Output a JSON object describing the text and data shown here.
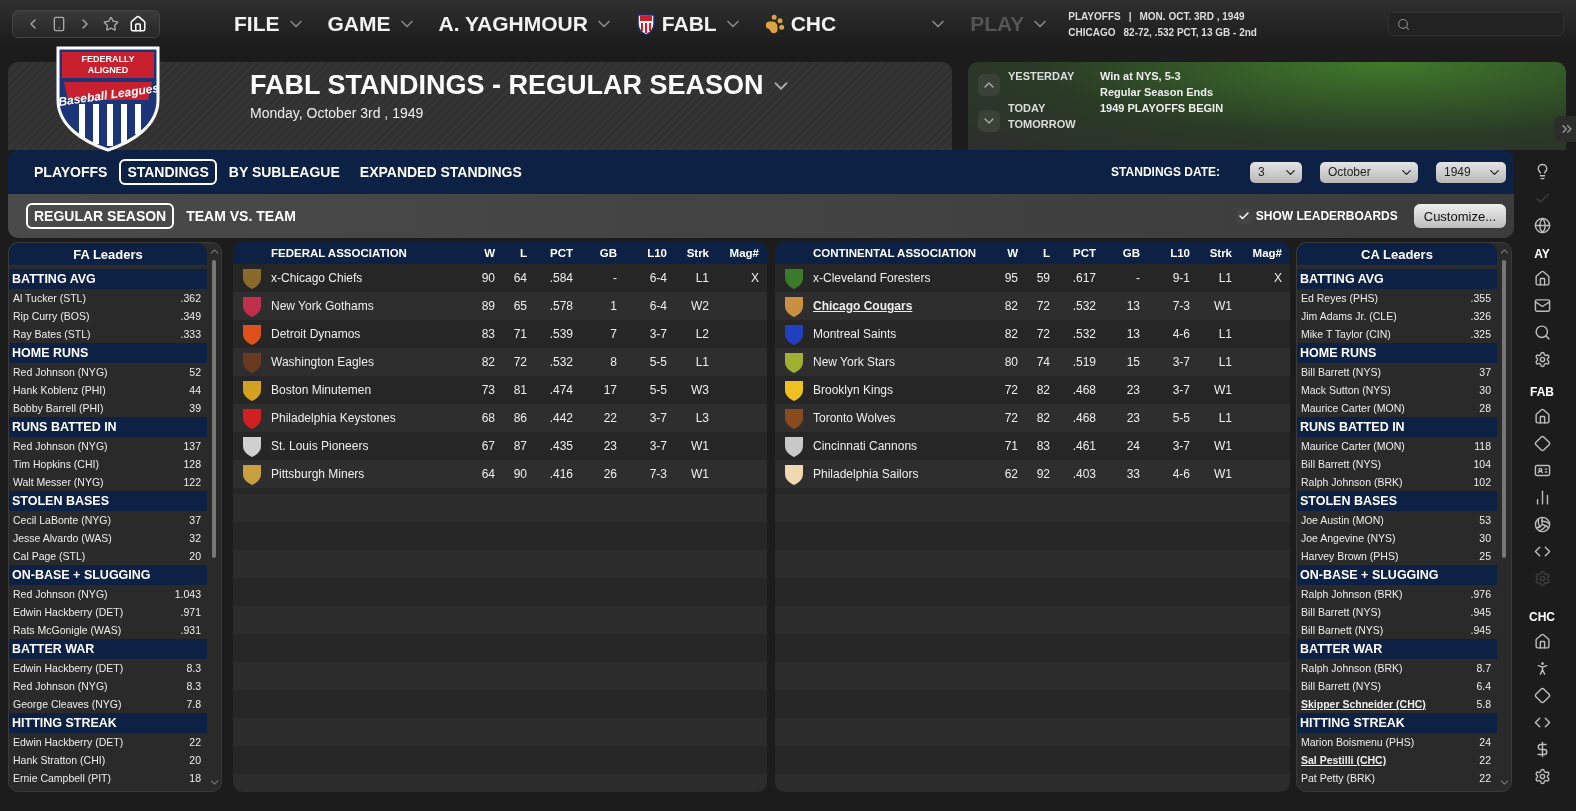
{
  "menu": [
    {
      "kind": "text",
      "label": "FILE",
      "caret": true,
      "disabled": false
    },
    {
      "kind": "text",
      "label": "GAME",
      "caret": true,
      "disabled": false
    },
    {
      "kind": "text",
      "label": "A. YAGHMOUR",
      "caret": true,
      "disabled": false
    },
    {
      "kind": "league",
      "label": "FABL",
      "caret": true,
      "disabled": false
    },
    {
      "kind": "team",
      "label": "CHC",
      "caret": false,
      "disabled": false
    },
    {
      "kind": "blank",
      "caret": true,
      "disabled": false
    },
    {
      "kind": "text",
      "label": "PLAY",
      "caret": true,
      "disabled": true
    }
  ],
  "status": {
    "phase": "PLAYOFFS",
    "separator": "|",
    "date": "MON. OCT. 3RD , 1949",
    "team": "CHICAGO",
    "record": "82-72, .532 PCT, 13 GB - 2nd"
  },
  "header": {
    "logo_lines": [
      "FEDERALLY",
      "ALIGNED",
      "Baseball Leagues"
    ],
    "title": "FABL STANDINGS - REGULAR SEASON",
    "subtitle": "Monday, October 3rd , 1949"
  },
  "schedule": [
    {
      "day": "YESTERDAY",
      "events": [
        "Win at NYS, 5-3",
        "Regular Season Ends"
      ]
    },
    {
      "day": "TODAY",
      "events": [
        "1949 PLAYOFFS BEGIN"
      ]
    },
    {
      "day": "TOMORROW"
    }
  ],
  "tabs": [
    {
      "label": "PLAYOFFS",
      "selected": false
    },
    {
      "label": "STANDINGS",
      "selected": true
    },
    {
      "label": "BY SUBLEAGUE",
      "selected": false
    },
    {
      "label": "EXPANDED STANDINGS",
      "selected": false
    }
  ],
  "standings_date": {
    "label": "STANDINGS DATE:",
    "day": "3",
    "month": "October",
    "year": "1949"
  },
  "subtabs": [
    {
      "label": "REGULAR SEASON",
      "selected": true
    },
    {
      "label": "TEAM VS. TEAM",
      "selected": false
    }
  ],
  "show_leaderboards": {
    "label": "SHOW LEADERBOARDS",
    "checked": true
  },
  "customize_button": "Customize...",
  "fa_leaders": {
    "title": "FA Leaders",
    "sections": [
      {
        "title": "BATTING AVG",
        "rows": [
          {
            "name": "Al Tucker (STL)",
            "value": ".362",
            "underlined": false
          },
          {
            "name": "Rip Curry (BOS)",
            "value": ".349",
            "underlined": false
          },
          {
            "name": "Ray Bates (STL)",
            "value": ".333",
            "underlined": false
          }
        ]
      },
      {
        "title": "HOME RUNS",
        "rows": [
          {
            "name": "Red Johnson (NYG)",
            "value": "52",
            "underlined": false
          },
          {
            "name": "Hank Koblenz (PHI)",
            "value": "44",
            "underlined": false
          },
          {
            "name": "Bobby Barrell (PHI)",
            "value": "39",
            "underlined": false
          }
        ]
      },
      {
        "title": "RUNS BATTED IN",
        "rows": [
          {
            "name": "Red Johnson (NYG)",
            "value": "137",
            "underlined": false
          },
          {
            "name": "Tim Hopkins (CHI)",
            "value": "128",
            "underlined": false
          },
          {
            "name": "Walt Messer (NYG)",
            "value": "122",
            "underlined": false
          }
        ]
      },
      {
        "title": "STOLEN BASES",
        "rows": [
          {
            "name": "Cecil LaBonte (NYG)",
            "value": "37",
            "underlined": false
          },
          {
            "name": "Jesse Alvardo (WAS)",
            "value": "32",
            "underlined": false
          },
          {
            "name": "Cal Page (STL)",
            "value": "20",
            "underlined": false
          }
        ]
      },
      {
        "title": "ON-BASE + SLUGGING",
        "rows": [
          {
            "name": "Red Johnson (NYG)",
            "value": "1.043",
            "underlined": false
          },
          {
            "name": "Edwin Hackberry (DET)",
            "value": ".971",
            "underlined": false
          },
          {
            "name": "Rats McGonigle (WAS)",
            "value": ".931",
            "underlined": false
          }
        ]
      },
      {
        "title": "BATTER WAR",
        "rows": [
          {
            "name": "Edwin Hackberry (DET)",
            "value": "8.3",
            "underlined": false
          },
          {
            "name": "Red Johnson (NYG)",
            "value": "8.3",
            "underlined": false
          },
          {
            "name": "George Cleaves (NYG)",
            "value": "7.8",
            "underlined": false
          }
        ]
      },
      {
        "title": "HITTING STREAK",
        "rows": [
          {
            "name": "Edwin Hackberry (DET)",
            "value": "22",
            "underlined": false
          },
          {
            "name": "Hank Stratton (CHI)",
            "value": "20",
            "underlined": false
          },
          {
            "name": "Ernie Campbell (PIT)",
            "value": "18",
            "underlined": false
          }
        ]
      }
    ]
  },
  "fa_standings": {
    "columns": [
      "FEDERAL ASSOCIATION",
      "W",
      "L",
      "PCT",
      "GB",
      "L10",
      "Strk",
      "Mag#"
    ],
    "rows": [
      {
        "color": "#8a6a2a",
        "underlined": false,
        "cells": [
          "x-Chicago Chiefs",
          "90",
          "64",
          ".584",
          "-",
          "6-4",
          "L1",
          "X"
        ]
      },
      {
        "color": "#c0304a",
        "underlined": false,
        "cells": [
          "New York Gothams",
          "89",
          "65",
          ".578",
          "1",
          "6-4",
          "W2",
          ""
        ]
      },
      {
        "color": "#e0501a",
        "underlined": false,
        "cells": [
          "Detroit Dynamos",
          "83",
          "71",
          ".539",
          "7",
          "3-7",
          "L2",
          ""
        ]
      },
      {
        "color": "#6a3a20",
        "underlined": false,
        "cells": [
          "Washington Eagles",
          "82",
          "72",
          ".532",
          "8",
          "5-5",
          "L1",
          ""
        ]
      },
      {
        "color": "#d4a020",
        "underlined": false,
        "cells": [
          "Boston Minutemen",
          "73",
          "81",
          ".474",
          "17",
          "5-5",
          "W3",
          ""
        ]
      },
      {
        "color": "#d02020",
        "underlined": false,
        "cells": [
          "Philadelphia Keystones",
          "68",
          "86",
          ".442",
          "22",
          "3-7",
          "L3",
          ""
        ]
      },
      {
        "color": "#d0d0d0",
        "underlined": false,
        "cells": [
          "St. Louis Pioneers",
          "67",
          "87",
          ".435",
          "23",
          "3-7",
          "W1",
          ""
        ]
      },
      {
        "color": "#c8a040",
        "underlined": false,
        "cells": [
          "Pittsburgh Miners",
          "64",
          "90",
          ".416",
          "26",
          "7-3",
          "W1",
          ""
        ]
      }
    ]
  },
  "ca_standings": {
    "columns": [
      "CONTINENTAL ASSOCIATION",
      "W",
      "L",
      "PCT",
      "GB",
      "L10",
      "Strk",
      "Mag#"
    ],
    "rows": [
      {
        "color": "#3a7a2a",
        "underlined": false,
        "cells": [
          "x-Cleveland Foresters",
          "95",
          "59",
          ".617",
          "-",
          "9-1",
          "L1",
          "X"
        ]
      },
      {
        "color": "#c89040",
        "underlined": true,
        "cells": [
          "Chicago Cougars",
          "82",
          "72",
          ".532",
          "13",
          "7-3",
          "W1",
          ""
        ]
      },
      {
        "color": "#2040c0",
        "underlined": false,
        "cells": [
          "Montreal Saints",
          "82",
          "72",
          ".532",
          "13",
          "4-6",
          "L1",
          ""
        ]
      },
      {
        "color": "#a0b030",
        "underlined": false,
        "cells": [
          "New York Stars",
          "80",
          "74",
          ".519",
          "15",
          "3-7",
          "L1",
          ""
        ]
      },
      {
        "color": "#f0c020",
        "underlined": false,
        "cells": [
          "Brooklyn Kings",
          "72",
          "82",
          ".468",
          "23",
          "3-7",
          "W1",
          ""
        ]
      },
      {
        "color": "#8a4a20",
        "underlined": false,
        "cells": [
          "Toronto Wolves",
          "72",
          "82",
          ".468",
          "23",
          "5-5",
          "L1",
          ""
        ]
      },
      {
        "color": "#c8c8c8",
        "underlined": false,
        "cells": [
          "Cincinnati Cannons",
          "71",
          "83",
          ".461",
          "24",
          "3-7",
          "W1",
          ""
        ]
      },
      {
        "color": "#f0d8b0",
        "underlined": false,
        "cells": [
          "Philadelphia Sailors",
          "62",
          "92",
          ".403",
          "33",
          "4-6",
          "W1",
          ""
        ]
      }
    ]
  },
  "ca_leaders": {
    "title": "CA Leaders",
    "sections": [
      {
        "title": "BATTING AVG",
        "rows": [
          {
            "name": "Ed Reyes (PHS)",
            "value": ".355",
            "underlined": false
          },
          {
            "name": "Jim Adams Jr. (CLE)",
            "value": ".326",
            "underlined": false
          },
          {
            "name": "Mike T Taylor (CIN)",
            "value": ".325",
            "underlined": false
          }
        ]
      },
      {
        "title": "HOME RUNS",
        "rows": [
          {
            "name": "Bill Barrett (NYS)",
            "value": "37",
            "underlined": false
          },
          {
            "name": "Mack Sutton (NYS)",
            "value": "30",
            "underlined": false
          },
          {
            "name": "Maurice Carter (MON)",
            "value": "28",
            "underlined": false
          }
        ]
      },
      {
        "title": "RUNS BATTED IN",
        "rows": [
          {
            "name": "Maurice Carter (MON)",
            "value": "118",
            "underlined": false
          },
          {
            "name": "Bill Barrett (NYS)",
            "value": "104",
            "underlined": false
          },
          {
            "name": "Ralph Johnson (BRK)",
            "value": "102",
            "underlined": false
          }
        ]
      },
      {
        "title": "STOLEN BASES",
        "rows": [
          {
            "name": "Joe Austin (MON)",
            "value": "53",
            "underlined": false
          },
          {
            "name": "Joe Angevine (NYS)",
            "value": "30",
            "underlined": false
          },
          {
            "name": "Harvey Brown (PHS)",
            "value": "25",
            "underlined": false
          }
        ]
      },
      {
        "title": "ON-BASE + SLUGGING",
        "rows": [
          {
            "name": "Ralph Johnson (BRK)",
            "value": ".976",
            "underlined": false
          },
          {
            "name": "Bill Barrett (NYS)",
            "value": ".945",
            "underlined": false
          },
          {
            "name": "Bill Barnett (NYS)",
            "value": ".945",
            "underlined": false
          }
        ]
      },
      {
        "title": "BATTER WAR",
        "rows": [
          {
            "name": "Ralph Johnson (BRK)",
            "value": "8.7",
            "underlined": false
          },
          {
            "name": "Bill Barrett (NYS)",
            "value": "6.4",
            "underlined": false
          },
          {
            "name": "Skipper Schneider (CHC)",
            "value": "5.8",
            "underlined": true
          }
        ]
      },
      {
        "title": "HITTING STREAK",
        "rows": [
          {
            "name": "Marion Boismenu (PHS)",
            "value": "24",
            "underlined": false
          },
          {
            "name": "Sal Pestilli (CHC)",
            "value": "22",
            "underlined": true
          },
          {
            "name": "Pat Petty (BRK)",
            "value": "22",
            "underlined": false
          }
        ]
      }
    ]
  },
  "sidebar": {
    "top": [
      {
        "disabled": false
      },
      {
        "disabled": true
      },
      {
        "disabled": false
      }
    ],
    "groups": [
      {
        "label": "AY",
        "icons": [
          {
            "disabled": false
          },
          {
            "disabled": false
          },
          {
            "disabled": false
          },
          {
            "disabled": false
          }
        ]
      },
      {
        "label": "FAB",
        "icons": [
          {
            "disabled": false
          },
          {
            "disabled": false
          },
          {
            "disabled": false
          },
          {
            "disabled": false
          },
          {
            "disabled": false
          },
          {
            "disabled": false
          },
          {
            "disabled": true
          }
        ]
      },
      {
        "label": "CHC",
        "icons": [
          {
            "disabled": false
          },
          {
            "disabled": false
          },
          {
            "disabled": false
          },
          {
            "disabled": false
          },
          {
            "disabled": false
          },
          {
            "disabled": false
          }
        ]
      }
    ]
  }
}
